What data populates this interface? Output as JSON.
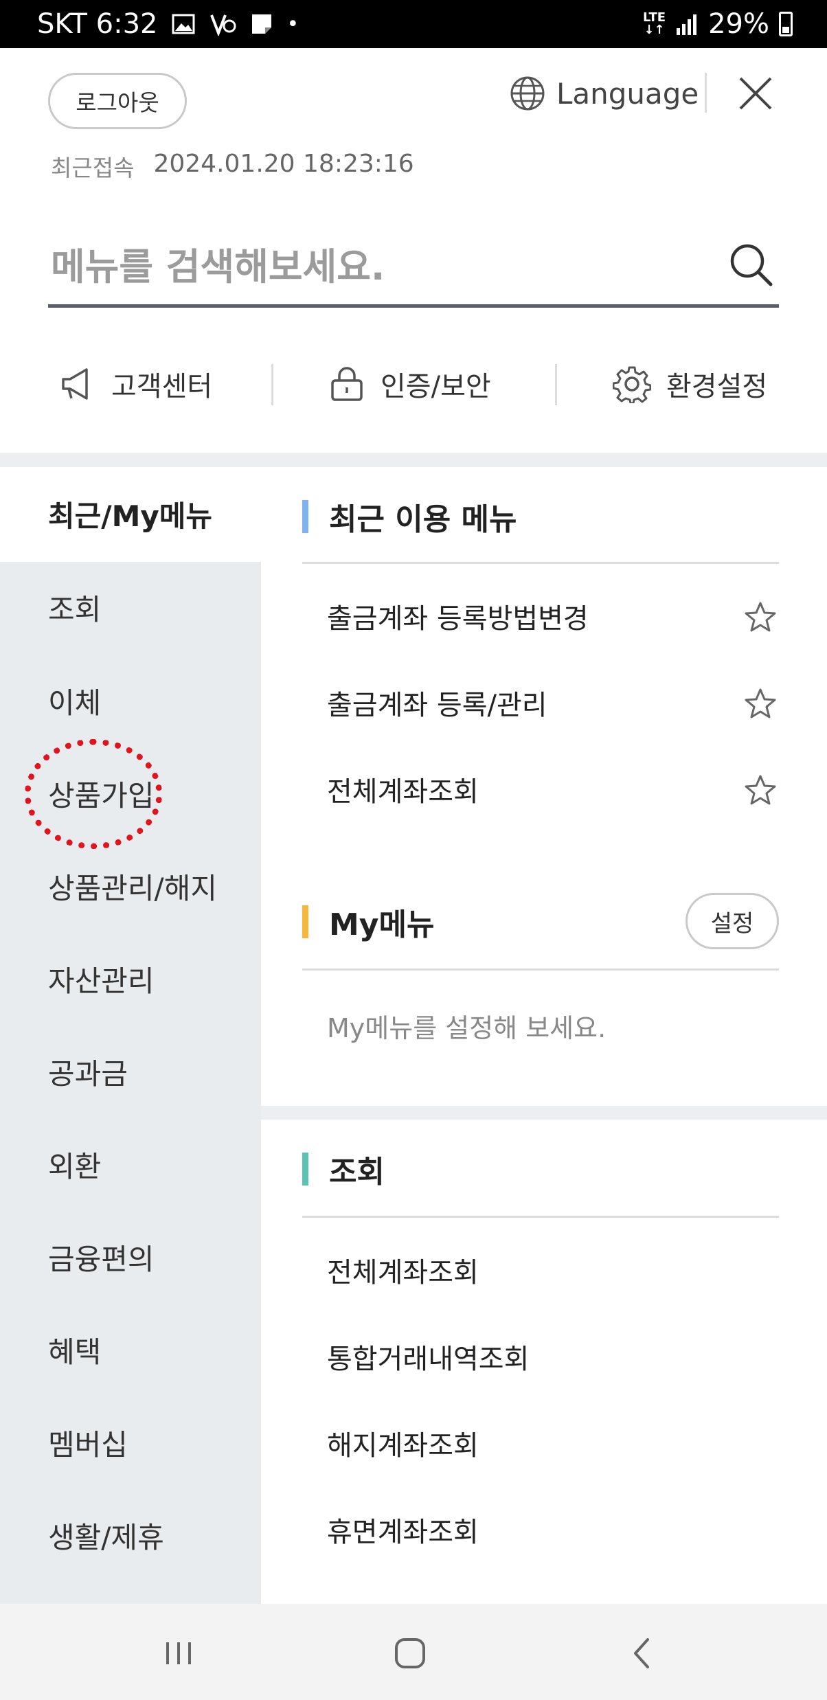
{
  "status_bar": {
    "carrier_time": "SKT 6:32",
    "network": "LTE",
    "battery": "29%"
  },
  "header": {
    "logout_label": "로그아웃",
    "language_label": "Language",
    "last_login_label": "최근접속",
    "last_login_value": "2024.01.20 18:23:16"
  },
  "search": {
    "placeholder": "메뉴를 검색해보세요."
  },
  "quick_links": [
    {
      "label": "고객센터",
      "icon": "megaphone-icon"
    },
    {
      "label": "인증/보안",
      "icon": "lock-icon"
    },
    {
      "label": "환경설정",
      "icon": "gear-icon"
    }
  ],
  "left_nav": [
    {
      "label": "최근/My메뉴"
    },
    {
      "label": "조회"
    },
    {
      "label": "이체"
    },
    {
      "label": "상품가입"
    },
    {
      "label": "상품관리/해지"
    },
    {
      "label": "자산관리"
    },
    {
      "label": "공과금"
    },
    {
      "label": "외환"
    },
    {
      "label": "금융편의"
    },
    {
      "label": "혜택"
    },
    {
      "label": "멤버십"
    },
    {
      "label": "생활/제휴"
    }
  ],
  "recent": {
    "title": "최근 이용 메뉴",
    "bar_color": "#7fb3f0",
    "items": [
      {
        "label": "출금계좌 등록방법변경"
      },
      {
        "label": "출금계좌 등록/관리"
      },
      {
        "label": "전체계좌조회"
      }
    ]
  },
  "my_menu": {
    "title": "My메뉴",
    "bar_color": "#f6b73c",
    "set_label": "설정",
    "empty_message": "My메뉴를 설정해 보세요."
  },
  "inquiry": {
    "title": "조회",
    "bar_color": "#5cc3b0",
    "items": [
      {
        "label": "전체계좌조회"
      },
      {
        "label": "통합거래내역조회"
      },
      {
        "label": "해지계좌조회"
      },
      {
        "label": "휴면계좌조회"
      }
    ]
  }
}
